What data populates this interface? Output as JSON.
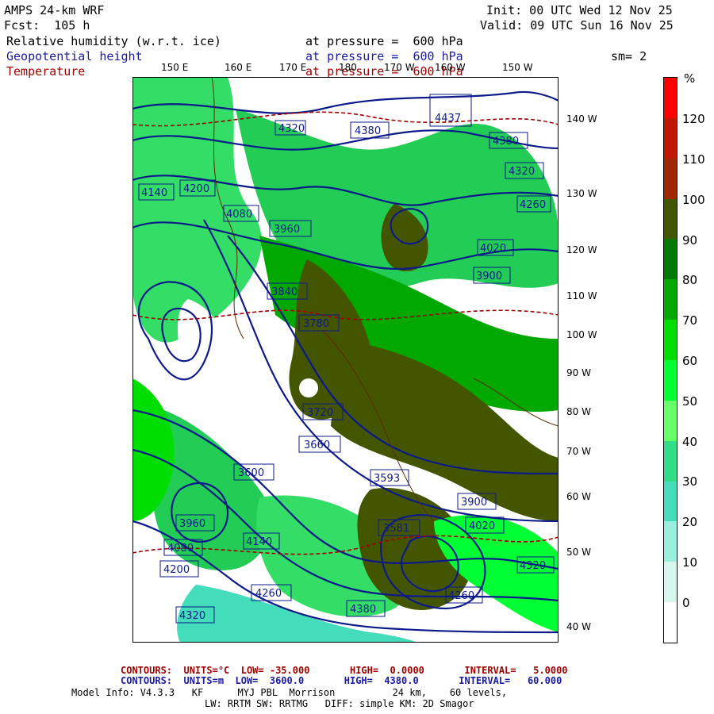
{
  "header": {
    "model": "AMPS 24-km WRF",
    "fcst": "Fcst:  105 h",
    "init": "Init: 00 UTC Wed 12 Nov 25",
    "valid": "Valid: 09 UTC Sun 16 Nov 25",
    "field1": "Relative humidity (w.r.t. ice)",
    "field1_level": "at pressure =  600 hPa",
    "field2": "Geopotential height",
    "field2_level": "at pressure =  600 hPa",
    "field3": "Temperature",
    "field3_level": "at pressure =  600 hPa",
    "smooth": "sm= 2"
  },
  "lon_labels": [
    "150 E",
    "160 E",
    "170 E",
    "180",
    "170 W",
    "160 W",
    "150 W"
  ],
  "lat_labels": [
    "140 W",
    "130 W",
    "120 W",
    "110 W",
    "100 W",
    "90 W",
    "80 W",
    "70 W",
    "60 W",
    "50 W",
    "40 W"
  ],
  "colorbar": {
    "unit": "%",
    "ticks": [
      "120",
      "110",
      "100",
      "90",
      "80",
      "70",
      "60",
      "50",
      "40",
      "30",
      "20",
      "10",
      "0"
    ],
    "colors": [
      "#ff0000",
      "#c01800",
      "#a02800",
      "#445500",
      "#007a00",
      "#00a800",
      "#00dd00",
      "#00ff33",
      "#66ff66",
      "#33dd88",
      "#44ddbb",
      "#99eedd",
      "#d8f5ee",
      "#ffffff"
    ]
  },
  "height_labels": [
    "4320",
    "4380",
    "4437",
    "4380",
    "4320",
    "4260",
    "4200",
    "4140",
    "4080",
    "4020",
    "3960",
    "3900",
    "3840",
    "3780",
    "3720",
    "3660",
    "3600",
    "3593",
    "3581",
    "3900",
    "3960",
    "4020",
    "4080",
    "4140",
    "4200",
    "4260",
    "4320",
    "4380",
    "4260",
    "4320"
  ],
  "footer": {
    "temp_contours": "CONTOURS:  UNITS=°C  LOW= -35.000       HIGH=  0.0000       INTERVAL=   5.0000",
    "hgt_contours": "CONTOURS:  UNITS=m  LOW=  3600.0       HIGH=  4380.0       INTERVAL=   60.000",
    "model_info": "Model Info: V4.3.3   KF      MYJ PBL  Morrison          24 km,    60 levels,",
    "model_info2": "LW: RRTM SW: RRTMG   DIFF: simple KM: 2D Smagor"
  }
}
